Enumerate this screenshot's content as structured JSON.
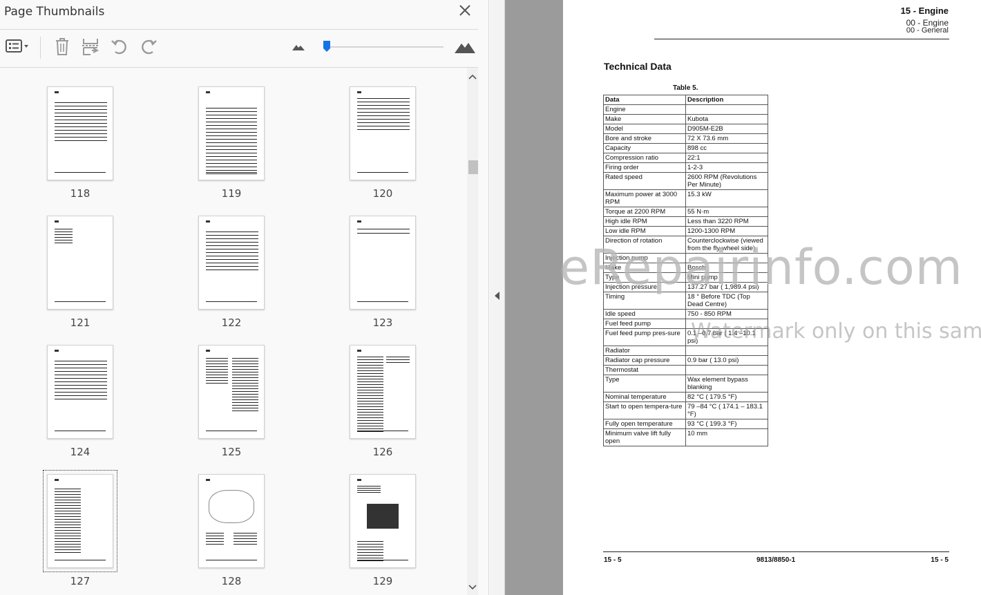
{
  "panel": {
    "title": "Page Thumbnails",
    "zoom_level": 0.0
  },
  "thumbnails": [
    {
      "label": "118",
      "style": "lines"
    },
    {
      "label": "119",
      "style": "toc"
    },
    {
      "label": "120",
      "style": "toc-short"
    },
    {
      "label": "121",
      "style": "list"
    },
    {
      "label": "122",
      "style": "lines"
    },
    {
      "label": "123",
      "style": "header"
    },
    {
      "label": "124",
      "style": "lines"
    },
    {
      "label": "125",
      "style": "two-col"
    },
    {
      "label": "126",
      "style": "text"
    },
    {
      "label": "127",
      "style": "table",
      "selected": true
    },
    {
      "label": "128",
      "style": "drawing"
    },
    {
      "label": "129",
      "style": "photo"
    }
  ],
  "doc": {
    "chapter": "15 - Engine",
    "sub1": "00 - Engine",
    "sub2": "00 - General",
    "section_title": "Technical Data",
    "table_caption": "Table 5.",
    "table_header": [
      "Data",
      "Description"
    ],
    "table_rows": [
      {
        "data": "Engine",
        "desc": "",
        "group": true
      },
      {
        "data": "Make",
        "desc": "Kubota"
      },
      {
        "data": "Model",
        "desc": "D905M-E2B"
      },
      {
        "data": "Bore and stroke",
        "desc": "72  X  73.6 mm"
      },
      {
        "data": "Capacity",
        "desc": "898 cc"
      },
      {
        "data": "Compression ratio",
        "desc": "22:1"
      },
      {
        "data": "Firing order",
        "desc": "1-2-3"
      },
      {
        "data": "Rated speed",
        "desc": "2600 RPM (Revolutions Per Minute)"
      },
      {
        "data": "Maximum power at 3000 RPM",
        "desc": "15.3 kW"
      },
      {
        "data": "Torque at 2200 RPM",
        "desc": "55 N·m"
      },
      {
        "data": "High idle RPM",
        "desc": "Less than 3220 RPM"
      },
      {
        "data": "Low idle RPM",
        "desc": "1200-1300 RPM"
      },
      {
        "data": "Direction of rotation",
        "desc": "Counterclockwise (viewed from the fly-wheel side)"
      },
      {
        "data": "Injection pump",
        "desc": "",
        "group": true
      },
      {
        "data": "Make",
        "desc": "Bosch"
      },
      {
        "data": "Type",
        "desc": "Mini pump"
      },
      {
        "data": "Injection pressure",
        "desc": "137.27 bar ( 1,989.4 psi)"
      },
      {
        "data": "Timing",
        "desc": "18 ° Before TDC (Top Dead Centre)"
      },
      {
        "data": "Idle speed",
        "desc": "750 - 850 RPM"
      },
      {
        "data": "Fuel feed pump",
        "desc": "",
        "group": true
      },
      {
        "data": "Fuel feed pump pres-sure",
        "desc": "0.1 –0.7 bar ( 1.4 –10.1 psi)"
      },
      {
        "data": "Radiator",
        "desc": "",
        "group": true
      },
      {
        "data": "Radiator cap pressure",
        "desc": "0.9 bar ( 13.0 psi)"
      },
      {
        "data": "Thermostat",
        "desc": "",
        "group": true
      },
      {
        "data": "Type",
        "desc": "Wax element bypass blanking"
      },
      {
        "data": "Nominal temperature",
        "desc": "82 °C ( 179.5 °F)"
      },
      {
        "data": "Start to open tempera-ture",
        "desc": "79 –84 °C ( 174.1 – 183.1 °F)"
      },
      {
        "data": "Fully open temperature",
        "desc": "93 °C ( 199.3 °F)"
      },
      {
        "data": "Minimum valve lift fully open",
        "desc": "10 mm"
      }
    ],
    "footer_left": "15 - 5",
    "footer_center": "9813/8850-1",
    "footer_right": "15 - 5"
  },
  "watermark": {
    "big": "eRepairinfo.com",
    "small": "Watermark only on this sample"
  },
  "colors": {
    "accent": "#1473e6",
    "icon_gray": "#6e6e6e",
    "doc_background": "#9b9b9b"
  }
}
